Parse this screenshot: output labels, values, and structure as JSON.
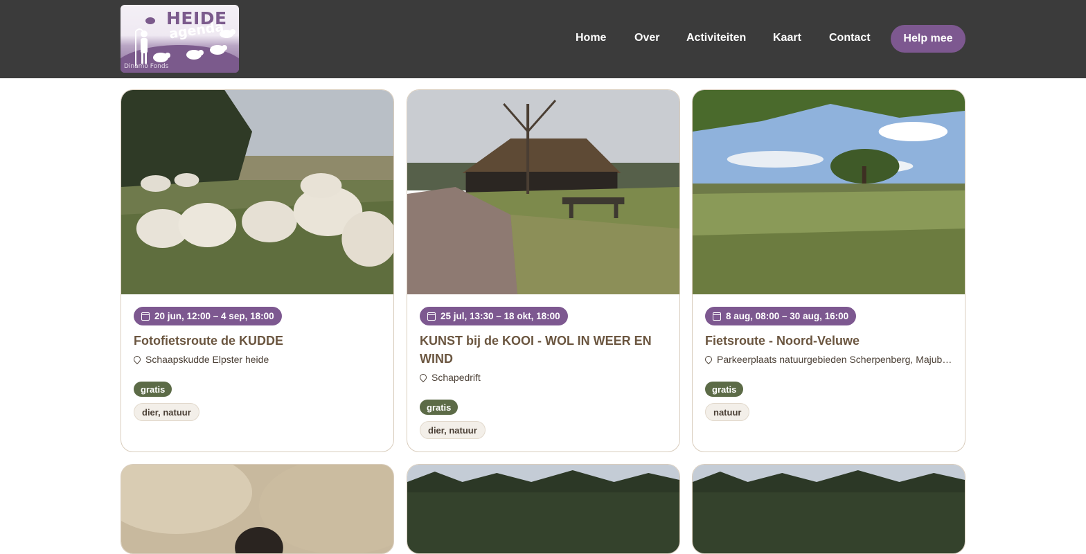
{
  "logo": {
    "line1": "HEIDE",
    "line2": "agenda",
    "line3": "Dinamo Fonds"
  },
  "nav": {
    "items": [
      {
        "label": "Home"
      },
      {
        "label": "Over"
      },
      {
        "label": "Activiteiten"
      },
      {
        "label": "Kaart"
      },
      {
        "label": "Contact"
      }
    ],
    "cta_label": "Help mee"
  },
  "colors": {
    "header": "#3b3b3b",
    "accent": "#7d5890",
    "green_tag": "#5c6b47",
    "title": "#6b5640"
  },
  "cards": [
    {
      "date": "20 jun, 12:00 – 4 sep, 18:00",
      "title": "Fotofietsroute de KUDDE",
      "location": "Schaapskudde Elpster heide",
      "price": "gratis",
      "categories": "dier, natuur",
      "image": "sheep-grazing-heath-photo"
    },
    {
      "date": "25 jul, 13:30 – 18 okt, 18:00",
      "title": "KUNST bij de KOOI - WOL IN WEER EN WIND",
      "location": "Schapedrift",
      "price": "gratis",
      "categories": "dier, natuur",
      "image": "sheepfold-barn-path-photo"
    },
    {
      "date": "8 aug, 08:00 – 30 aug, 16:00",
      "title": "Fietsroute - Noord-Veluwe",
      "location": "Parkeerplaats natuurgebieden Scherpenberg, Majuba, Hof van Ermelo, Ermelo",
      "price": "gratis",
      "categories": "natuur",
      "image": "heathland-trees-photo"
    }
  ]
}
